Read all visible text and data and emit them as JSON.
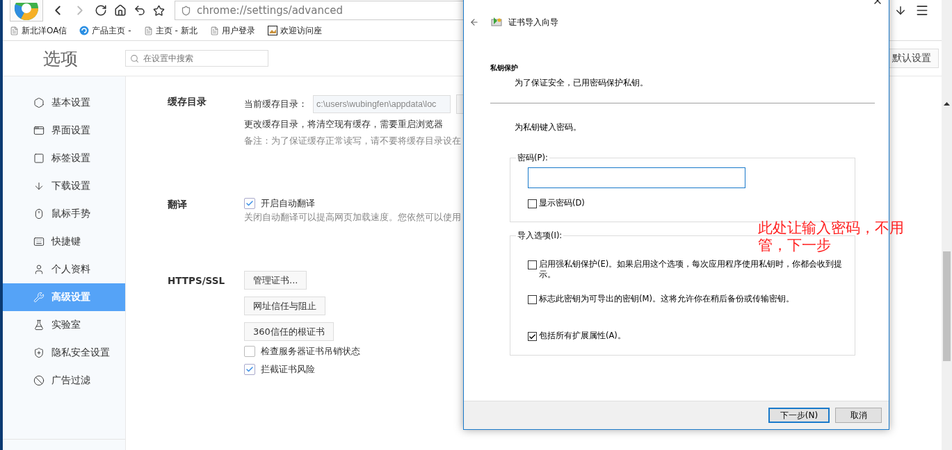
{
  "browser": {
    "address": "chrome://settings/advanced",
    "bookmarks": [
      {
        "label": "新北洋OA信",
        "kind": "page"
      },
      {
        "label": "产品主页 -",
        "kind": "swirl"
      },
      {
        "label": "主页 - 新北",
        "kind": "page"
      },
      {
        "label": "用户登录",
        "kind": "page"
      },
      {
        "label": "欢迎访问座",
        "kind": "image"
      }
    ]
  },
  "settings": {
    "title": "选项",
    "search_placeholder": "在设置中搜索",
    "reset_button": "默认设置",
    "sidebar": [
      {
        "label": "基本设置",
        "kind": "hexagon",
        "selected": false
      },
      {
        "label": "界面设置",
        "kind": "window",
        "selected": false
      },
      {
        "label": "标签设置",
        "kind": "tab",
        "selected": false
      },
      {
        "label": "下载设置",
        "kind": "download",
        "selected": false
      },
      {
        "label": "鼠标手势",
        "kind": "mouse",
        "selected": false
      },
      {
        "label": "快捷键",
        "kind": "key",
        "selected": false
      },
      {
        "label": "个人资料",
        "kind": "user",
        "selected": false
      },
      {
        "label": "高级设置",
        "kind": "wrench",
        "selected": true
      },
      {
        "label": "实验室",
        "kind": "flask",
        "selected": false
      },
      {
        "label": "隐私安全设置",
        "kind": "shield",
        "selected": false
      },
      {
        "label": "广告过滤",
        "kind": "block",
        "selected": false
      }
    ],
    "cache": {
      "label": "缓存目录",
      "field_label": "当前缓存目录：",
      "path": "c:\\users\\wubingfen\\appdata\\loc",
      "note": "更改缓存目录，将清空现有缓存，需要重启浏览器",
      "hint": "备注：为了保证缓存正常读写，请不要将缓存目录设在"
    },
    "translate": {
      "label": "翻译",
      "option": {
        "label": "开启自动翻译",
        "checked": true
      },
      "hint": "关闭自动翻译可以提高网页加载速度。您依然可以使用"
    },
    "https": {
      "label": "HTTPS/SSL",
      "buttons": [
        "管理证书...",
        "网址信任与阻止",
        "360信任的根证书"
      ],
      "options": [
        {
          "label": "检查服务器证书吊销状态",
          "checked": false
        },
        {
          "label": "拦截证书风险",
          "checked": true
        }
      ]
    }
  },
  "dialog": {
    "title": "证书导入向导",
    "heading": "私钥保护",
    "subheading": "为了保证安全，已用密码保护私钥。",
    "prompt": "为私钥键入密码。",
    "password_group": {
      "legend": "密码(P):",
      "show_password": {
        "label": "显示密码(D)",
        "checked": false
      }
    },
    "options_group": {
      "legend": "导入选项(I):",
      "options": [
        {
          "label": "启用强私钥保护(E)。如果启用这个选项，每次应用程序使用私钥时，你都会收到提示。",
          "checked": false
        },
        {
          "label": "标志此密钥为可导出的密钥(M)。这将允许你在稍后备份或传输密钥。",
          "checked": false
        },
        {
          "label": "包括所有扩展属性(A)。",
          "checked": true
        }
      ]
    },
    "buttons": [
      {
        "label": "下一步(N)",
        "default": true
      },
      {
        "label": "取消",
        "default": false
      }
    ]
  },
  "annotation": "此处让输入密码，不用管，下一步"
}
